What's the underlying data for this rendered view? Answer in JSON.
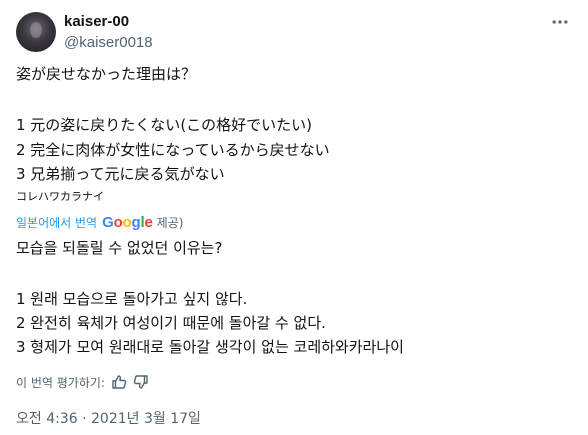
{
  "author": {
    "display_name": "kaiser-00",
    "handle": "@kaiser0018"
  },
  "original": {
    "line1": "姿が戻せなかった理由は？",
    "line2": " 1 元の姿に戻りたくない(この格好でいたい)",
    "line3": " 2 完全に肉体が女性になっているから戻せない",
    "line4": "3 兄弟揃って元に戻る気がない",
    "line5": "コレハワカラナイ"
  },
  "translation": {
    "link_label": "일본어에서 번역",
    "provider_logo": {
      "G": "G",
      "o1": "o",
      "o2": "o",
      "g": "g",
      "l": "l",
      "e": "e"
    },
    "provided_label": "제공)",
    "line1": "모습을 되돌릴 수 없었던 이유는?",
    "line2": "1 원래 모습으로 돌아가고 싶지 않다.",
    "line3": "2 완전히 육체가 여성이기 때문에 돌아갈 수 없다.",
    "line4": "3 형제가 모여 원래대로 돌아갈 생각이 없는 코레하와카라나이"
  },
  "rating": {
    "label": "이 번역 평가하기:",
    "up_icon": "thumbs-up-icon",
    "down_icon": "thumbs-down-icon"
  },
  "timestamp": {
    "time": "오전 4:36",
    "separator": " · ",
    "date": "2021년 3월 17일"
  },
  "colors": {
    "text": "#0f1419",
    "muted": "#536471",
    "link": "#1d9bf0"
  },
  "icons": {
    "more": "more-horizontal-icon"
  }
}
